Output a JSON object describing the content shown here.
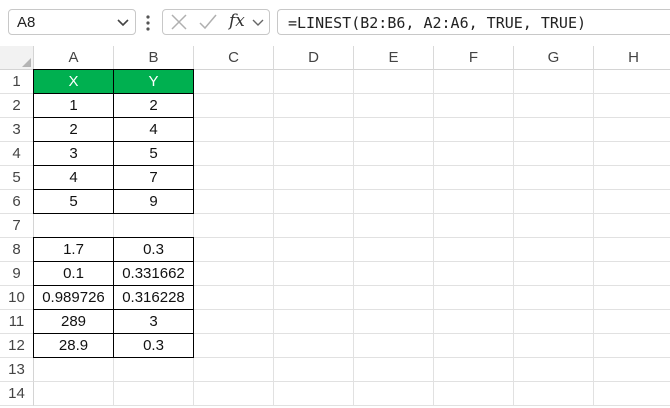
{
  "formula_bar": {
    "name_box": "A8",
    "formula": "=LINEST(B2:B6, A2:A6, TRUE, TRUE)",
    "fx_label": "fx"
  },
  "columns": [
    "A",
    "B",
    "C",
    "D",
    "E",
    "F",
    "G",
    "H"
  ],
  "rows": [
    "1",
    "2",
    "3",
    "4",
    "5",
    "6",
    "7",
    "8",
    "9",
    "10",
    "11",
    "12",
    "13",
    "14"
  ],
  "cells": {
    "A1": "X",
    "B1": "Y",
    "A2": "1",
    "B2": "2",
    "A3": "2",
    "B3": "4",
    "A4": "3",
    "B4": "5",
    "A5": "4",
    "B5": "7",
    "A6": "5",
    "B6": "9",
    "A8": "1.7",
    "B8": "0.3",
    "A9": "0.1",
    "B9": "0.331662",
    "A10": "0.989726",
    "B10": "0.316228",
    "A11": "289",
    "B11": "3",
    "A12": "28.9",
    "B12": "0.3"
  },
  "colors": {
    "header_fill": "#00b050",
    "header_text": "#ffffff"
  }
}
